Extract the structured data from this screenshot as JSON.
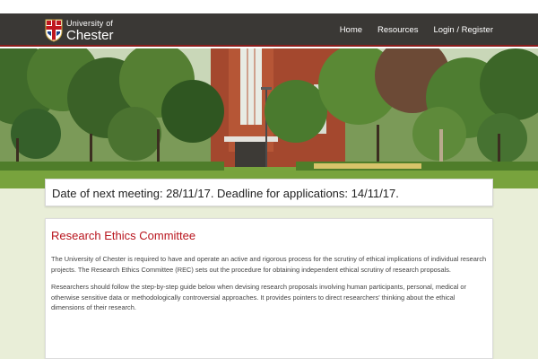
{
  "header": {
    "logo_small": "University of",
    "logo_big": "Chester",
    "nav": [
      {
        "label": "Home"
      },
      {
        "label": "Resources"
      },
      {
        "label": "Login / Register"
      }
    ]
  },
  "notice": {
    "text": "Date of next meeting: 28/11/17. Deadline for applications: 14/11/17."
  },
  "main": {
    "title": "Research Ethics Committee",
    "paragraphs": [
      "The University of Chester is required to have and operate an active and rigorous process for the scrutiny of ethical implications of individual research projects. The Research Ethics Committee (REC) sets out the procedure for obtaining independent ethical scrutiny of research proposals.",
      "Researchers should follow the step-by-step guide below when devising research proposals involving human participants, personal, medical or otherwise sensitive data or methodologically controversial approaches. It provides pointers to direct researchers' thinking about the ethical dimensions of their research."
    ]
  },
  "colors": {
    "navbar": "#3a3835",
    "accent_red": "#b8141d",
    "page_bg": "#e9eed8"
  },
  "icons": {
    "crest": "university-crest-icon"
  }
}
